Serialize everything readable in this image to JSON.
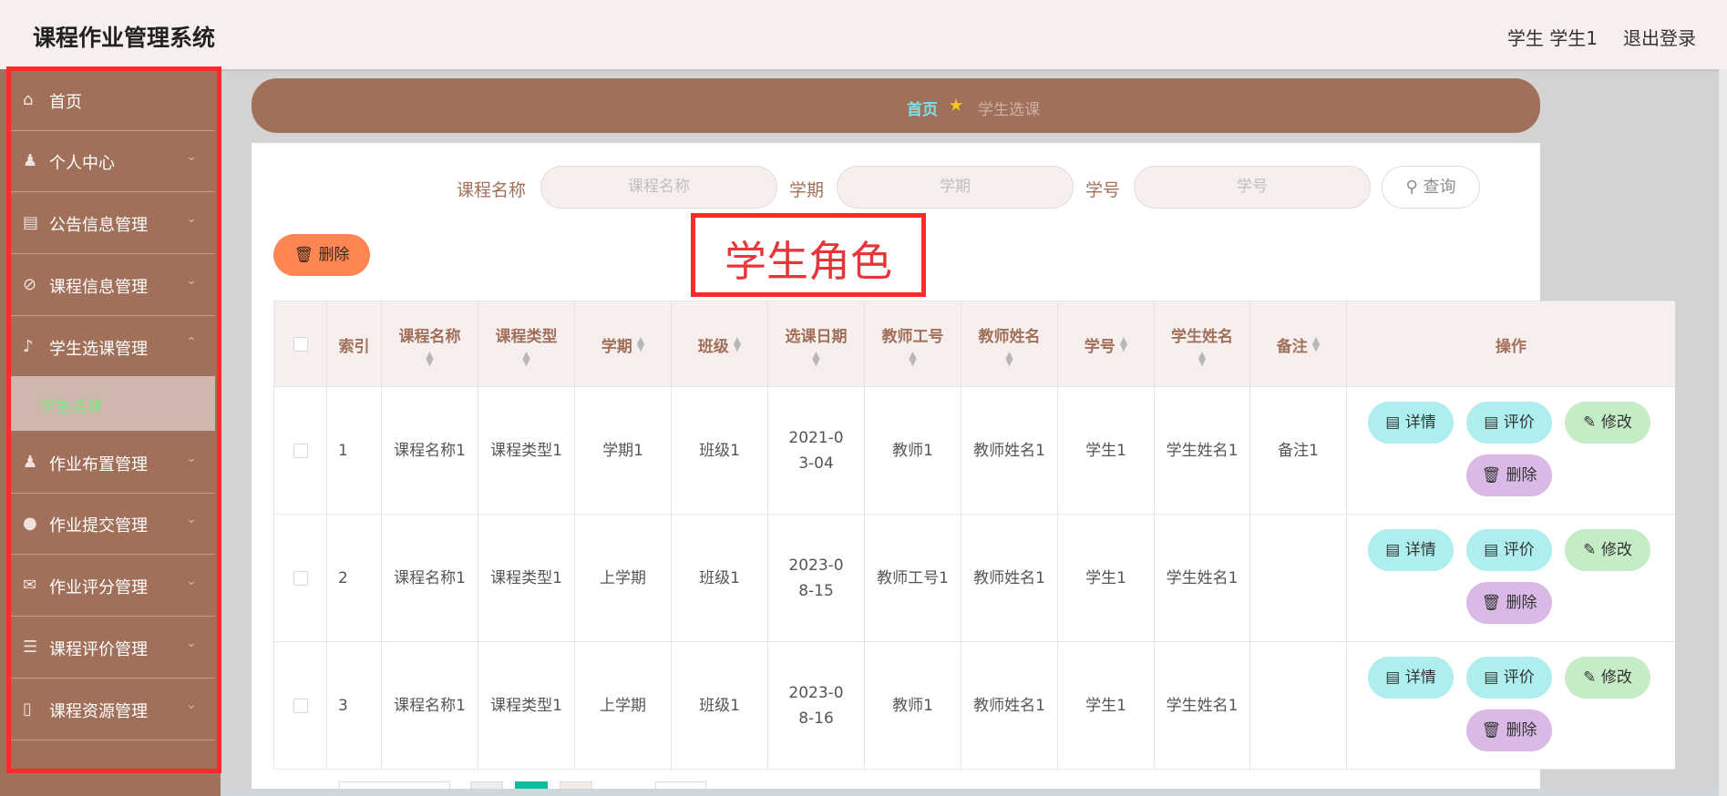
{
  "header": {
    "app_title": "课程作业管理系统",
    "user_info": "学生 学生1",
    "logout": "退出登录"
  },
  "sidebar": {
    "items": [
      {
        "label": "首页",
        "icon": "home-icon"
      },
      {
        "label": "个人中心",
        "icon": "user-icon"
      },
      {
        "label": "公告信息管理",
        "icon": "clipboard-icon"
      },
      {
        "label": "课程信息管理",
        "icon": "bell-off-icon"
      },
      {
        "label": "学生选课管理",
        "icon": "microphone-icon"
      },
      {
        "label": "作业布置管理",
        "icon": "person-stand-icon"
      },
      {
        "label": "作业提交管理",
        "icon": "location-pin-icon"
      },
      {
        "label": "作业评分管理",
        "icon": "mail-icon"
      },
      {
        "label": "课程评价管理",
        "icon": "list-icon"
      },
      {
        "label": "课程资源管理",
        "icon": "phone-icon"
      }
    ],
    "active_sub": "学生选课"
  },
  "breadcrumb": {
    "home": "首页",
    "current": "学生选课"
  },
  "search": {
    "course_label": "课程名称",
    "course_placeholder": "课程名称",
    "term_label": "学期",
    "term_placeholder": "学期",
    "student_no_label": "学号",
    "student_no_placeholder": "学号",
    "query_button": "查询"
  },
  "toolbar": {
    "delete_label": "删除"
  },
  "annotation": "学生角色",
  "table": {
    "headers": [
      "索引",
      "课程名称",
      "课程类型",
      "学期",
      "班级",
      "选课日期",
      "教师工号",
      "教师姓名",
      "学号",
      "学生姓名",
      "备注",
      "操作"
    ],
    "rows": [
      [
        "1",
        "课程名称1",
        "课程类型1",
        "学期1",
        "班级1",
        "2021-03-04",
        "教师1",
        "教师姓名1",
        "学生1",
        "学生姓名1",
        "备注1"
      ],
      [
        "2",
        "课程名称1",
        "课程类型1",
        "上学期",
        "班级1",
        "2023-08-15",
        "教师工号1",
        "教师姓名1",
        "学生1",
        "学生姓名1",
        ""
      ],
      [
        "3",
        "课程名称1",
        "课程类型1",
        "上学期",
        "班级1",
        "2023-08-16",
        "教师1",
        "教师姓名1",
        "学生1",
        "学生姓名1",
        ""
      ]
    ],
    "actions": {
      "detail": "详情",
      "rate": "评价",
      "edit": "修改",
      "delete": "删除"
    }
  },
  "colors": {
    "brand_brown": "#a1705a",
    "delete_orange": "#ff8553",
    "annotation_red": "#ff2a2a"
  }
}
